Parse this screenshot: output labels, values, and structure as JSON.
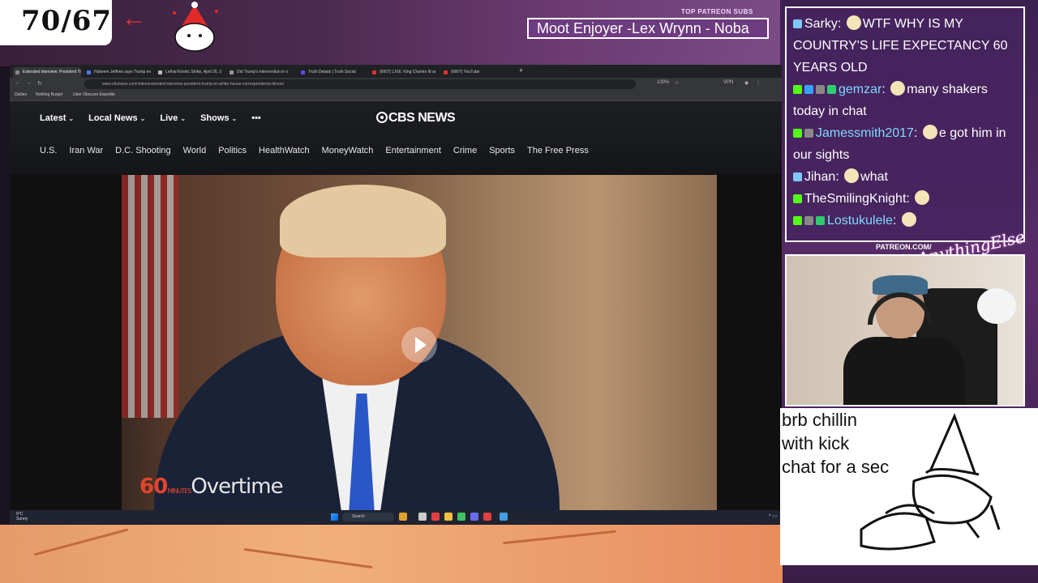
{
  "overlay": {
    "counter": "70/67",
    "patreon_label": "TOP PATREON SUBS",
    "patreon_ticker": "Moot Enjoyer -Lex Wrynn -  Noba",
    "patreon_tag": "PATREON.COM/",
    "brand_logo": "AnythingElse",
    "brb_text": "brb chillin\nwith kick\nchat for a sec"
  },
  "browser": {
    "tabs": [
      {
        "title": "Extended interview: President Tr",
        "fav": "#888888",
        "active": true
      },
      {
        "title": "Hakeem Jeffries says Trump en",
        "fav": "#4a7cf0"
      },
      {
        "title": "Lethal Kinetic Strike, April 26, 2",
        "fav": "#bbbbbb"
      },
      {
        "title": "Did Trump's intervention in o",
        "fav": "#999999"
      },
      {
        "title": "Truth Details | Truth Social",
        "fav": "#5a4ae0"
      },
      {
        "title": "(6607) LIVE: King Charles III ar",
        "fav": "#e03030"
      },
      {
        "title": "(6607) YouTube",
        "fav": "#e03030"
      }
    ],
    "new_tab": "+",
    "url": "www.cbsnews.com/video/extended-interview-president-trump-on-white-house-correspondents-dinner/",
    "zoom": "100%",
    "vpn": "VPN",
    "bookmarks": [
      "Dailies",
      "Nothing Burger",
      "Uber Obscure Expedite"
    ]
  },
  "cbs": {
    "logo": "CBS NEWS",
    "primary_nav": [
      "Latest",
      "Local News",
      "Live",
      "Shows"
    ],
    "more": "•••",
    "secondary_nav": [
      "U.S.",
      "Iran War",
      "D.C. Shooting",
      "World",
      "Politics",
      "HealthWatch",
      "MoneyWatch",
      "Entertainment",
      "Crime",
      "Sports",
      "The Free Press"
    ],
    "video_brand_number": "60",
    "video_brand_small": "MINUTES",
    "video_brand_word": "Overtime"
  },
  "taskbar": {
    "weather_temp": "9°C",
    "weather_desc": "Sunny",
    "search": "Search"
  },
  "chat": [
    {
      "user": "Sarky",
      "text": "WTF WHY IS MY COUNTRY'S LIFE EXPECTANCY 60 YEARS OLD",
      "color": "#ffffff",
      "badges": [
        "#7ec8ff"
      ]
    },
    {
      "user": "gemzar",
      "text": "many shakers today in chat",
      "color": "#7fd8ff",
      "badges": [
        "#53fc18",
        "#3aa0ff",
        "#888888",
        "#2ecc71"
      ]
    },
    {
      "user": "Jamessmith2017",
      "text": "e got him in our sights",
      "color": "#7fd8ff",
      "badges": [
        "#53fc18",
        "#888888"
      ]
    },
    {
      "user": "Jihan",
      "text": "what",
      "color": "#ffffff",
      "badges": [
        "#7ec8ff"
      ]
    },
    {
      "user": "TheSmilingKnight",
      "text": "",
      "color": "#ffffff",
      "badges": [
        "#53fc18"
      ]
    },
    {
      "user": "Lostukulele",
      "text": "",
      "color": "#7fd8ff",
      "badges": [
        "#53fc18",
        "#888888",
        "#2ecc71"
      ]
    }
  ]
}
